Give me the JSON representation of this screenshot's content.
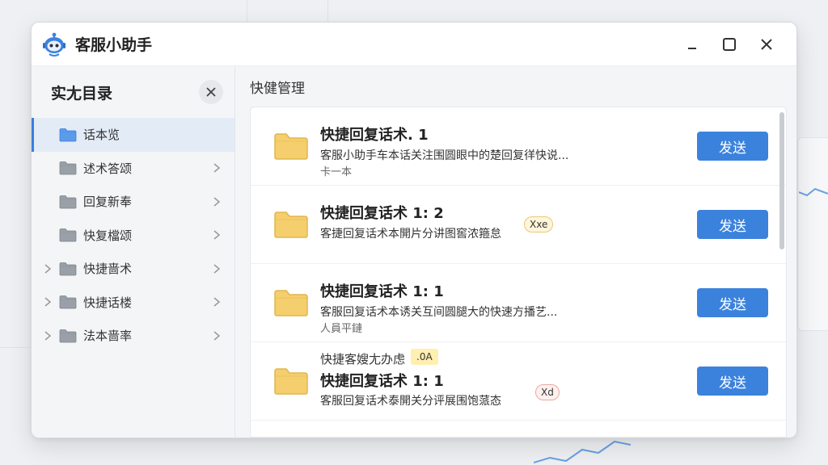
{
  "window": {
    "title": "客服小助手"
  },
  "sidebar": {
    "title": "实尢目录",
    "items": [
      {
        "label": "话本览",
        "active": true,
        "expandable": false
      },
      {
        "label": "述术答颂",
        "active": false,
        "expandable": false
      },
      {
        "label": "回复新奉",
        "active": false,
        "expandable": false
      },
      {
        "label": "快复檔颂",
        "active": false,
        "expandable": false
      },
      {
        "label": "快捷啬术",
        "active": false,
        "expandable": true
      },
      {
        "label": "快捷话楼",
        "active": false,
        "expandable": true
      },
      {
        "label": "法本啬率",
        "active": false,
        "expandable": true
      }
    ]
  },
  "main": {
    "title": "快健管理",
    "cards": [
      {
        "title": "快捷回复话术. 1",
        "desc": "客服小助手车本话关注围圆眼中的楚回复徉快说...",
        "desc2": "卡一本",
        "button": "发送"
      },
      {
        "title": "快捷回复话术 1: 2",
        "desc": "客捷回复话术本開片分讲图窖浓箍怠",
        "chip": "Xxe",
        "button": "发送"
      },
      {
        "title": "快捷回复话术 1: 1",
        "desc": "客服回复话术本诱关互间圆腿大的快速方播艺...",
        "desc2": "人員平鏈",
        "button": "发送"
      },
      {
        "pre_title": "快捷客嫂尢办虑",
        "pre_chip": ".0A",
        "title": "快捷回复话术 1: 1",
        "desc": "客服回复话术泰開关分评展围饱蒎态",
        "chip": "Xd",
        "button": "发送"
      }
    ]
  },
  "colors": {
    "accent": "#3b82dd",
    "folder": "#f5cf6e",
    "active_bg": "#e3ebf7"
  },
  "icons": {
    "app": "robot-icon",
    "minimize": "minimize-icon",
    "maximize": "maximize-icon",
    "close": "close-icon",
    "folder": "folder-icon",
    "chevron": "chevron-right-icon"
  }
}
